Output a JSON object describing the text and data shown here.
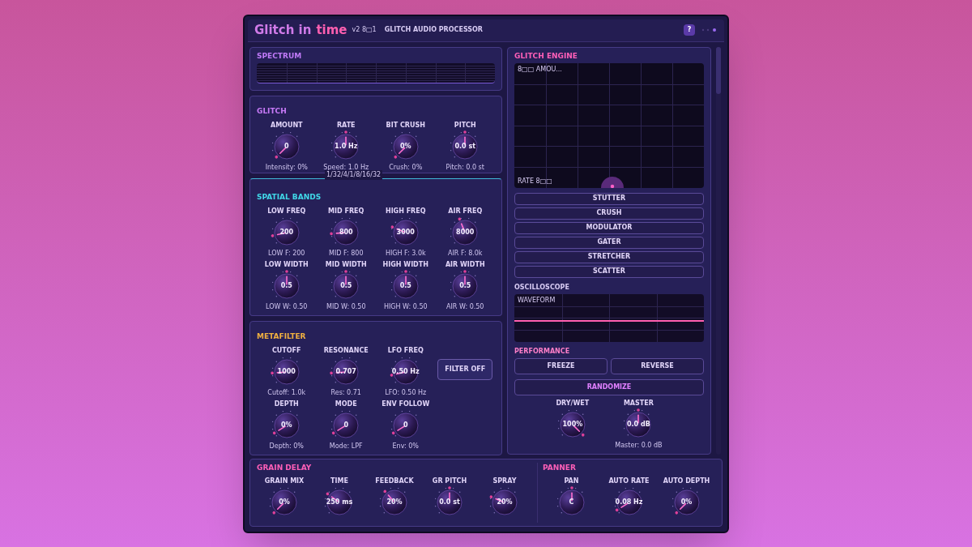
{
  "header": {
    "title": "Glitch in",
    "title_accent": "time",
    "version": "v2 8□1",
    "subtitle": "GLITCH AUDIO PROCESSOR",
    "help": "?"
  },
  "spectrum": {
    "title": "SPECTRUM"
  },
  "glitch": {
    "title": "GLITCH",
    "rate_divisions": "1/32/4/1/8/16/32",
    "knobs": [
      {
        "label": "AMOUNT",
        "value": "0",
        "level": 0,
        "readout": "Intensity: 0%"
      },
      {
        "label": "RATE",
        "value": "1.0 Hz",
        "level": 0.5,
        "readout": "Speed: 1.0 Hz"
      },
      {
        "label": "BIT CRUSH",
        "value": "0%",
        "level": 0,
        "readout": "Crush: 0%"
      },
      {
        "label": "PITCH",
        "value": "0.0 st",
        "level": 0.5,
        "readout": "Pitch: 0.0 st"
      }
    ]
  },
  "spatial_bands": {
    "title": "SPATIAL BANDS",
    "rows": [
      [
        {
          "label": "LOW FREQ",
          "value": "200",
          "level": 0.12,
          "readout": "LOW F: 200"
        },
        {
          "label": "MID FREQ",
          "value": "800",
          "level": 0.15,
          "readout": "MID F: 800"
        },
        {
          "label": "HIGH FREQ",
          "value": "3000",
          "level": 0.25,
          "readout": "HIGH F: 3.0k"
        },
        {
          "label": "AIR FREQ",
          "value": "8000",
          "level": 0.42,
          "readout": "AIR F: 8.0k"
        }
      ],
      [
        {
          "label": "LOW WIDTH",
          "value": "0.5",
          "level": 0.5,
          "readout": "LOW W: 0.50"
        },
        {
          "label": "MID WIDTH",
          "value": "0.5",
          "level": 0.5,
          "readout": "MID W: 0.50"
        },
        {
          "label": "HIGH WIDTH",
          "value": "0.5",
          "level": 0.5,
          "readout": "HIGH W: 0.50"
        },
        {
          "label": "AIR WIDTH",
          "value": "0.5",
          "level": 0.5,
          "readout": "AIR W: 0.50"
        }
      ]
    ]
  },
  "metafilter": {
    "title": "METAFILTER",
    "filter_button": "FILTER OFF",
    "rows": [
      [
        {
          "label": "CUTOFF",
          "value": "1000",
          "level": 0.15,
          "readout": "Cutoff: 1.0k"
        },
        {
          "label": "RESONANCE",
          "value": "0.707",
          "level": 0.15,
          "readout": "Res: 0.71"
        },
        {
          "label": "LFO FREQ",
          "value": "0.50 Hz",
          "level": 0.12,
          "readout": "LFO: 0.50 Hz"
        }
      ],
      [
        {
          "label": "DEPTH",
          "value": "0%",
          "level": 0.05,
          "readout": "Depth: 0%"
        },
        {
          "label": "MODE",
          "value": "0",
          "level": 0.05,
          "readout": "Mode: LPF"
        },
        {
          "label": "ENV FOLLOW",
          "value": "0",
          "level": 0.05,
          "readout": "Env: 0%"
        }
      ]
    ]
  },
  "glitch_engine": {
    "title": "GLITCH ENGINE",
    "xy_pad": {
      "x_label": "8□□ AMOU...",
      "y_label": "RATE 8□□"
    },
    "modes": [
      {
        "label": "STUTTER",
        "selected": false
      },
      {
        "label": "CRUSH",
        "selected": false
      },
      {
        "label": "MODULATOR",
        "selected": false
      },
      {
        "label": "GATER",
        "selected": false
      },
      {
        "label": "STRETCHER",
        "selected": false
      },
      {
        "label": "SCATTER",
        "selected": false
      }
    ]
  },
  "oscilloscope": {
    "title": "OSCILLOSCOPE",
    "label": "WAVEFORM"
  },
  "performance": {
    "title": "PERFORMANCE",
    "buttons": [
      "FREEZE",
      "REVERSE"
    ],
    "randomize": "RANDOMIZE",
    "knobs": [
      {
        "label": "DRY/WET",
        "value": "100%",
        "level": 1
      },
      {
        "label": "MASTER",
        "value": "0.0 dB",
        "level": 0.5,
        "readout": "Master: 0.0 dB"
      }
    ]
  },
  "grain_delay": {
    "title": "GRAIN DELAY",
    "knobs": [
      {
        "label": "GRAIN MIX",
        "value": "0%",
        "level": 0
      },
      {
        "label": "TIME",
        "value": "250 ms",
        "level": 0.3
      },
      {
        "label": "FEEDBACK",
        "value": "20%",
        "level": 0.35
      },
      {
        "label": "GR PITCH",
        "value": "0.0 st",
        "level": 0.5
      },
      {
        "label": "SPRAY",
        "value": "20%",
        "level": 0.25
      }
    ]
  },
  "panner": {
    "title": "PANNER",
    "knobs": [
      {
        "label": "PAN",
        "value": "C",
        "level": 0.5
      },
      {
        "label": "AUTO RATE",
        "value": "0.08 Hz",
        "level": 0.05
      },
      {
        "label": "AUTO DEPTH",
        "value": "0%",
        "level": 0
      }
    ]
  }
}
